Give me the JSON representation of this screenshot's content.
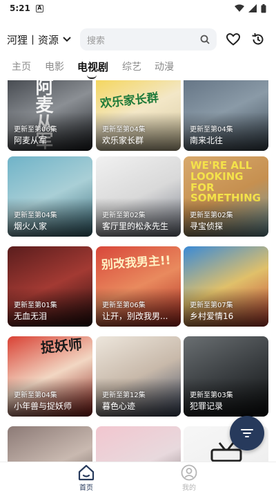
{
  "status_bar": {
    "time": "5:21",
    "notification_badge": "A",
    "icons": [
      "wifi-icon",
      "signal-icon",
      "battery-icon"
    ]
  },
  "header": {
    "source_label": "河狸丨资源",
    "search_placeholder": "搜索"
  },
  "tabs": [
    {
      "label": "主页",
      "active": false
    },
    {
      "label": "电影",
      "active": false
    },
    {
      "label": "电视剧",
      "active": true
    },
    {
      "label": "综艺",
      "active": false
    },
    {
      "label": "动漫",
      "active": false
    }
  ],
  "cards": [
    {
      "episode": "更新至第06集",
      "title": "阿麦从军",
      "colors": [
        "#3b3f45",
        "#8b8f94",
        "#1f2226"
      ],
      "overlay_text": "阿麦从军"
    },
    {
      "episode": "更新至第04集",
      "title": "欢乐家长群",
      "colors": [
        "#f4d34b",
        "#f3e7c7",
        "#d6c9a2"
      ],
      "overlay_text": "欢乐家长群"
    },
    {
      "episode": "更新至第04集",
      "title": "南来北往",
      "colors": [
        "#5f6f80",
        "#8a9aa7",
        "#3d4a55"
      ],
      "overlay_text": ""
    },
    {
      "episode": "更新至第04集",
      "title": "烟火人家",
      "colors": [
        "#6fb3c8",
        "#a9cfd6",
        "#3b6e7d"
      ],
      "overlay_text": ""
    },
    {
      "episode": "更新至第02集",
      "title": "客厅里的松永先生",
      "colors": [
        "#f1f1f1",
        "#d9d9d9",
        "#7a7f8c"
      ],
      "overlay_text": ""
    },
    {
      "episode": "更新至第02集",
      "title": "寻宝侦探",
      "colors": [
        "#d8a96d",
        "#c69050",
        "#6d9aa4"
      ],
      "overlay_text": "WE'RE ALL LOOKING FOR SOMETHING"
    },
    {
      "episode": "更新至第01集",
      "title": "无血无泪",
      "colors": [
        "#5a1d1d",
        "#a33a33",
        "#2a0e0e"
      ],
      "overlay_text": ""
    },
    {
      "episode": "更新至第06集",
      "title": "让开，别改我男...",
      "colors": [
        "#d8473a",
        "#e98a5e",
        "#b02c22"
      ],
      "overlay_text": "别改我男主!!"
    },
    {
      "episode": "更新至第07集",
      "title": "乡村爱情16",
      "colors": [
        "#3a8ad6",
        "#e0c06a",
        "#c24033"
      ],
      "overlay_text": ""
    },
    {
      "episode": "更新至第04集",
      "title": "小年兽与捉妖师",
      "colors": [
        "#d94134",
        "#f2d7c3",
        "#8d1e17"
      ],
      "overlay_text": "捉妖师"
    },
    {
      "episode": "更新至第12集",
      "title": "暮色心迹",
      "colors": [
        "#ede6dc",
        "#c8b9aa",
        "#3e4b63"
      ],
      "overlay_text": ""
    },
    {
      "episode": "更新至第03集",
      "title": "犯罪记录",
      "colors": [
        "#6a6f72",
        "#3a3e41",
        "#0d0f10"
      ],
      "overlay_text": ""
    },
    {
      "episode": "",
      "title": "",
      "colors": [
        "#8c7a76",
        "#c9b9b0",
        "#4b403d"
      ],
      "overlay_text": ""
    },
    {
      "episode": "",
      "title": "",
      "colors": [
        "#f2c6cf",
        "#e8d9dd",
        "#6a5f62"
      ],
      "overlay_text": ""
    },
    {
      "episode": "",
      "title": "",
      "colors": [
        "#f7f7f7",
        "#f0f0f0",
        "#e9e9e9"
      ],
      "overlay_text": ""
    }
  ],
  "bottom_nav": [
    {
      "label": "首页",
      "icon": "home-icon",
      "active": true
    },
    {
      "label": "我的",
      "icon": "profile-icon",
      "active": false
    }
  ],
  "theme": {
    "accent": "#273a5c",
    "active_text": "#111111",
    "inactive_text": "#8a8a8a"
  }
}
